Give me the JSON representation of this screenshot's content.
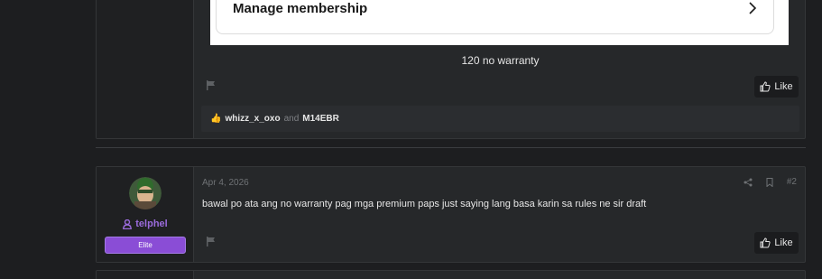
{
  "post1": {
    "embed_title": "Manage membership",
    "caption": "120 no warranty",
    "like_label": "Like",
    "reactions": {
      "emoji": "👍",
      "user_a": "whizz_x_oxo",
      "conjunction": "and",
      "user_b": "M14EBR"
    }
  },
  "post2": {
    "username": "telphel",
    "user_title": "Elite",
    "date": "Apr 4, 2026",
    "post_number": "#2",
    "body": "bawal po ata ang no warranty pag mga premium paps just saying lang basa karin sa rules ne sir draft",
    "like_label": "Like"
  },
  "colors": {
    "accent_purple": "#9b6bdc",
    "badge_bg": "#8a4dd6",
    "background": "#1d1e20"
  },
  "icons": {
    "chevron": "chevron-right-icon",
    "flag": "flag-icon",
    "like": "thumbs-up-icon",
    "share": "share-icon",
    "bookmark": "bookmark-icon",
    "user": "user-icon"
  }
}
